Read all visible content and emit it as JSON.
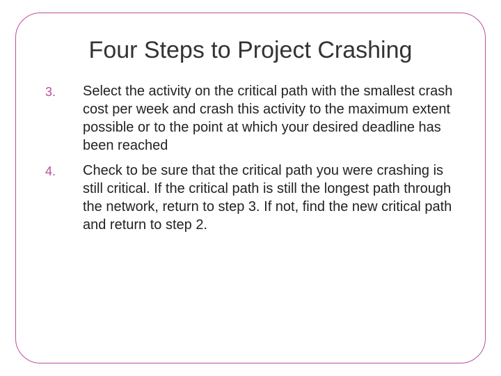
{
  "title": "Four Steps to Project Crashing",
  "items": [
    {
      "num": "3.",
      "text": "Select the activity on the critical path with the smallest crash cost per week and crash this activity to the maximum extent possible or to the point at which your desired deadline has been reached"
    },
    {
      "num": "4.",
      "text": "Check to be sure that the critical path you were crashing is still critical. If the critical path is still the longest path through the network, return to step 3. If not, find the new critical path and return to step 2."
    }
  ]
}
